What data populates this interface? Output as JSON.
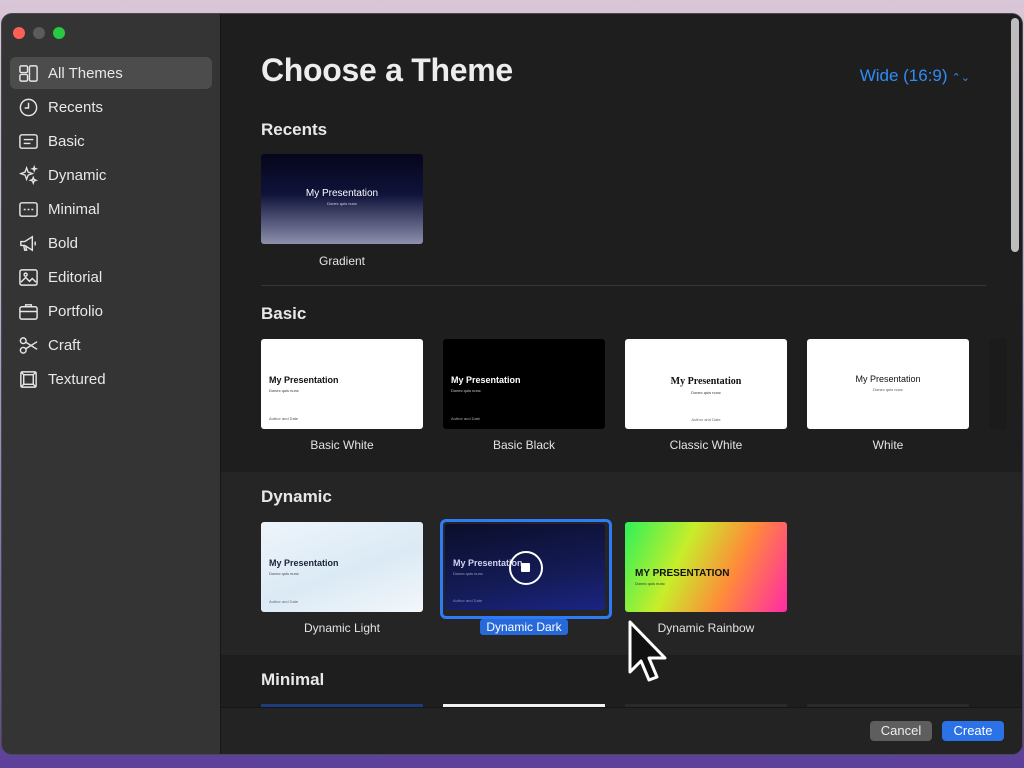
{
  "window": {
    "title": "Choose a Theme",
    "size_option": "Wide (16:9)"
  },
  "sidebar": {
    "items": [
      {
        "label": "All Themes",
        "icon": "grid-icon",
        "active": true
      },
      {
        "label": "Recents",
        "icon": "clock-icon"
      },
      {
        "label": "Basic",
        "icon": "text-box-icon"
      },
      {
        "label": "Dynamic",
        "icon": "sparkles-icon"
      },
      {
        "label": "Minimal",
        "icon": "rectangle-dashed-icon"
      },
      {
        "label": "Bold",
        "icon": "megaphone-icon"
      },
      {
        "label": "Editorial",
        "icon": "photo-icon"
      },
      {
        "label": "Portfolio",
        "icon": "briefcase-icon"
      },
      {
        "label": "Craft",
        "icon": "scissors-icon"
      },
      {
        "label": "Textured",
        "icon": "frame-icon"
      }
    ]
  },
  "sections": {
    "recents": {
      "title": "Recents",
      "themes": [
        {
          "name": "Gradient",
          "slide_title": "My Presentation",
          "slide_sub": "Donec quis nunc"
        }
      ]
    },
    "basic": {
      "title": "Basic",
      "themes": [
        {
          "name": "Basic White",
          "slide_title": "My Presentation",
          "slide_sub": "Donec quis nunc",
          "slide_foot": "Author and Date"
        },
        {
          "name": "Basic Black",
          "slide_title": "My Presentation",
          "slide_sub": "Donec quis nunc",
          "slide_foot": "Author and Date"
        },
        {
          "name": "Classic White",
          "slide_title": "My Presentation",
          "slide_sub": "Donec quis nunc",
          "slide_foot": "Author and Date"
        },
        {
          "name": "White",
          "slide_title": "My Presentation",
          "slide_sub": "Donec quis nunc"
        }
      ]
    },
    "dynamic": {
      "title": "Dynamic",
      "themes": [
        {
          "name": "Dynamic Light",
          "slide_title": "My Presentation",
          "slide_sub": "Donec quis nunc",
          "slide_foot": "Author and Date"
        },
        {
          "name": "Dynamic Dark",
          "slide_title": "My Presentation",
          "slide_sub": "Donec quis nunc",
          "slide_foot": "Author and Date",
          "selected": true
        },
        {
          "name": "Dynamic Rainbow",
          "slide_title": "MY PRESENTATION",
          "slide_sub": "Donec quis nunc"
        }
      ]
    },
    "minimal": {
      "title": "Minimal"
    }
  },
  "footer": {
    "cancel_label": "Cancel",
    "create_label": "Create"
  },
  "colors": {
    "accent": "#2f7bf5",
    "window_bg": "#1e1e1e",
    "sidebar_bg": "#343434"
  }
}
